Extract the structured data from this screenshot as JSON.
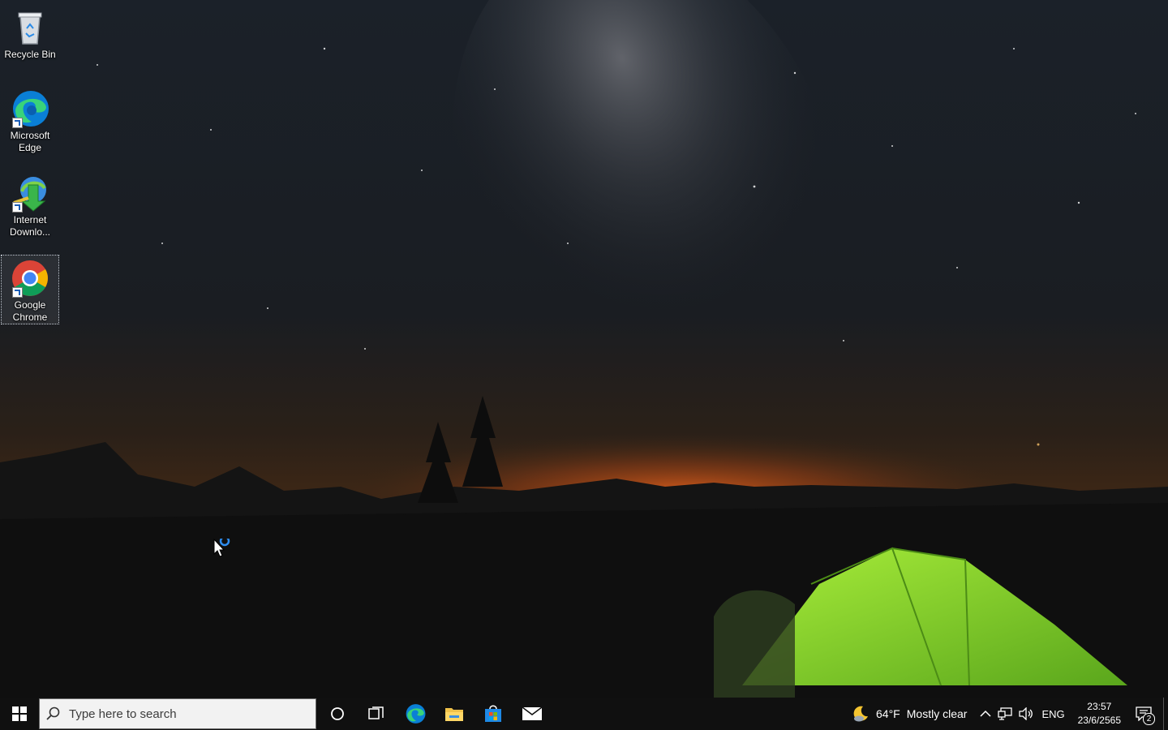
{
  "desktop": {
    "icons": [
      {
        "label": "Recycle Bin",
        "icon": "recycle-bin-icon"
      },
      {
        "label": "Microsoft Edge",
        "icon": "edge-icon"
      },
      {
        "label": "Internet Downlo...",
        "icon": "internet-download-manager-icon"
      },
      {
        "label": "Google Chrome",
        "icon": "chrome-icon"
      }
    ]
  },
  "taskbar": {
    "start_icon": "windows-logo-icon",
    "search_placeholder": "Type here to search",
    "pinned": [
      "cortana-icon",
      "task-view-icon",
      "edge-icon",
      "file-explorer-icon",
      "microsoft-store-icon",
      "mail-icon"
    ],
    "weather": {
      "temp": "64°F",
      "condition": "Mostly clear",
      "icon": "moon-cloud-icon"
    },
    "language": "ENG",
    "time": "23:57",
    "date": "23/6/2565",
    "notification_count": "2"
  },
  "colors": {
    "taskbar_bg": "#101010",
    "tent_green": "#7fd02a",
    "horizon_glow": "#e2601c",
    "accent_blue": "#0078d4"
  }
}
